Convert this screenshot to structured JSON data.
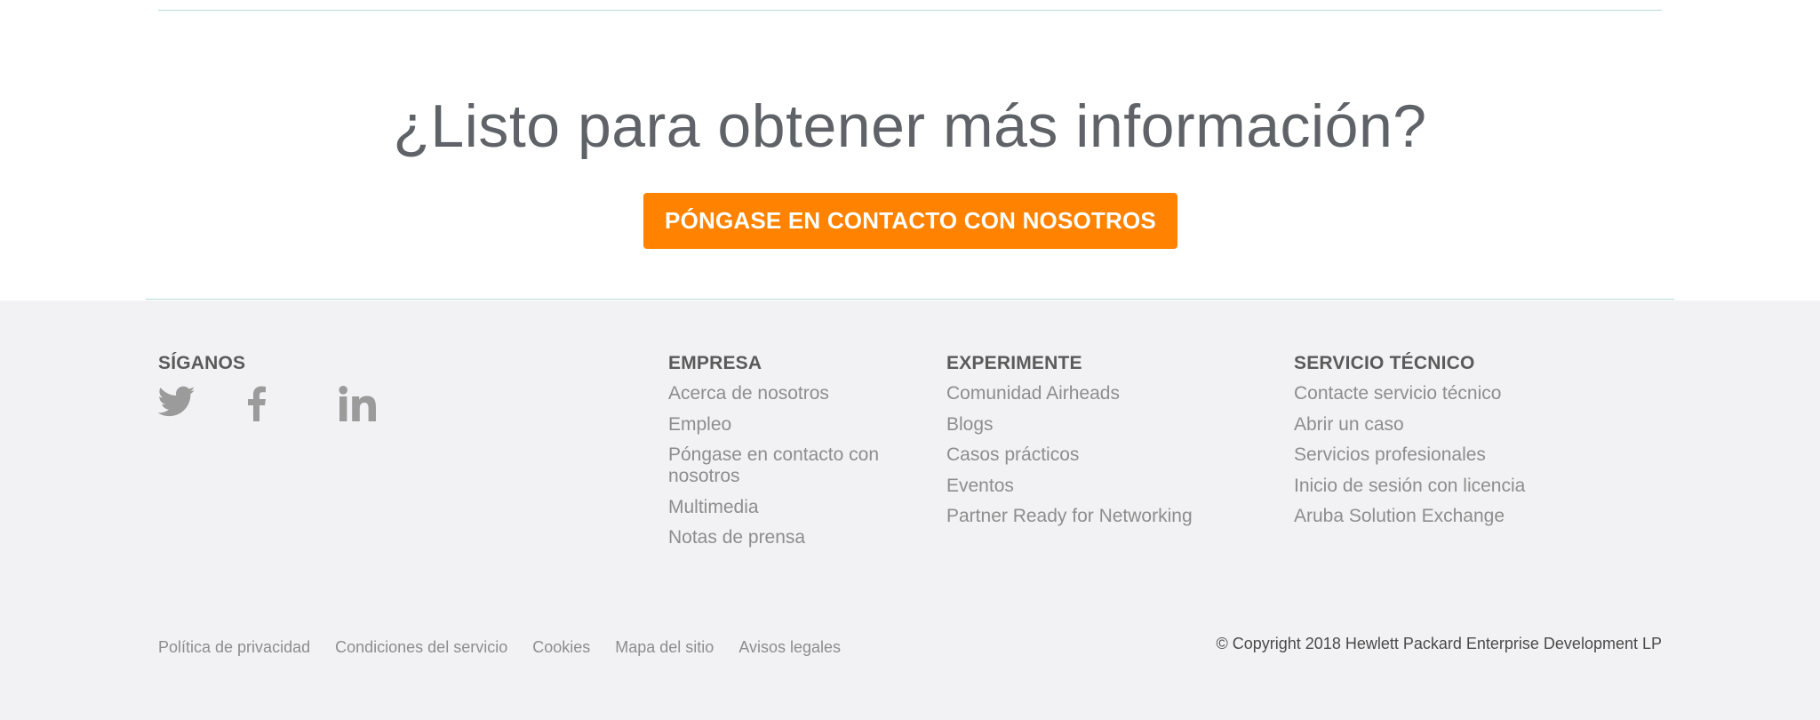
{
  "cta": {
    "headline": "¿Listo para obtener más información?",
    "button_label": "PÓNGASE EN CONTACTO CON NOSOTROS",
    "accent_color": "#ff8300"
  },
  "footer": {
    "follow": {
      "heading": "SÍGANOS",
      "icons": [
        "twitter-icon",
        "facebook-icon",
        "linkedin-icon"
      ]
    },
    "empresa": {
      "heading": "EMPRESA",
      "items": [
        "Acerca de nosotros",
        "Empleo",
        "Póngase en contacto con nosotros",
        "Multimedia",
        "Notas de prensa"
      ]
    },
    "experimente": {
      "heading": "EXPERIMENTE",
      "items": [
        "Comunidad Airheads",
        "Blogs",
        "Casos prácticos",
        "Eventos",
        "Partner Ready for Networking"
      ]
    },
    "servicio": {
      "heading": "SERVICIO TÉCNICO",
      "items": [
        "Contacte servicio técnico",
        "Abrir un caso",
        "Servicios profesionales",
        "Inicio de sesión con licencia",
        "Aruba Solution Exchange"
      ]
    },
    "legal_links": [
      "Política de privacidad",
      "Condiciones del servicio",
      "Cookies",
      "Mapa del sitio",
      "Avisos legales"
    ],
    "copyright": "© Copyright 2018 Hewlett Packard Enterprise Development LP"
  }
}
